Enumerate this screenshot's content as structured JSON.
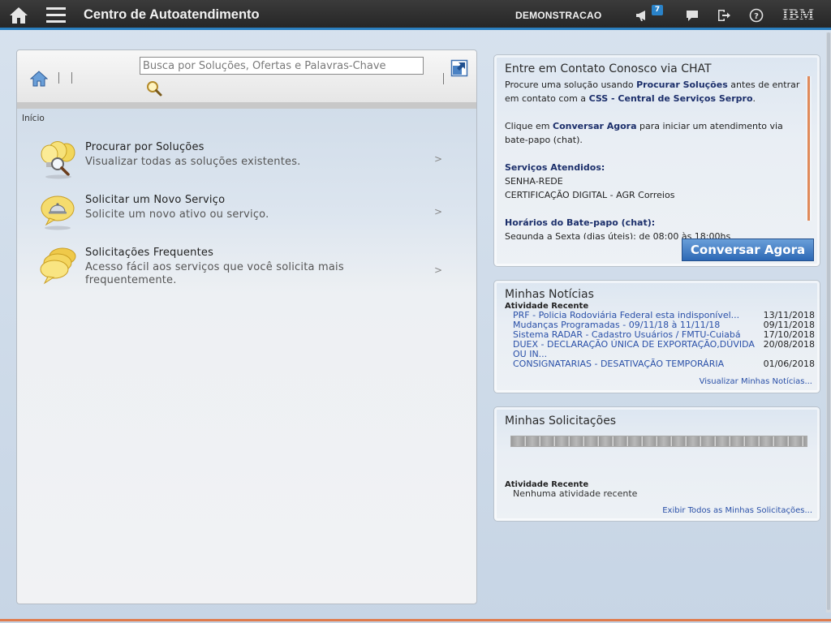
{
  "topbar": {
    "title": "Centro de Autoatendimento",
    "user": "DEMONSTRACAO",
    "notification_count": "7",
    "brand": "IBM",
    "accent_color": "#2a7fbf"
  },
  "search": {
    "placeholder": "Busca por Soluções, Ofertas e Palavras-Chave"
  },
  "breadcrumb": "Início",
  "menu": [
    {
      "title": "Procurar por Soluções",
      "description": "Visualizar todas as soluções existentes.",
      "icon": "lightbulb-search-icon",
      "chevron": ">"
    },
    {
      "title": "Solicitar um Novo Serviço",
      "description": "Solicite um novo ativo ou serviço.",
      "icon": "service-bell-icon",
      "chevron": ">"
    },
    {
      "title": "Solicitações Frequentes",
      "description": "Acesso fácil aos serviços que você solicita mais frequentemente.",
      "icon": "speech-bubbles-icon",
      "chevron": ">"
    }
  ],
  "chat": {
    "title": "Entre em Contato Conosco via CHAT",
    "p1_a": "Procure uma solução usando ",
    "p1_b": "Procurar Soluções",
    "p1_c": " antes de entrar em contato com a ",
    "p1_d": "CSS - Central de Serviços Serpro",
    "p1_e": ".",
    "p2_a": "Clique em ",
    "p2_b": "Conversar Agora",
    "p2_c": " para iniciar um atendimento via bate-papo (chat).",
    "services_label": "Serviços Atendidos:",
    "service_1": "SENHA-REDE",
    "service_2": "CERTIFICAÇÃO DIGITAL - AGR Correios",
    "hours_label": "Horários do Bate-papo (chat):",
    "hours_text": "Segunda a Sexta (dias úteis): de 08:00 às 18:00hs",
    "button": "Conversar Agora"
  },
  "news": {
    "title": "Minhas Notícias",
    "subtitle": "Atividade Recente",
    "items": [
      {
        "title": "PRF - Policia Rodoviária Federal esta indisponível...",
        "date": "13/11/2018"
      },
      {
        "title": "Mudanças Programadas - 09/11/18 à 11/11/18",
        "date": "09/11/2018"
      },
      {
        "title": "Sistema RADAR - Cadastro Usuários / FMTU-Cuiabá",
        "date": "17/10/2018"
      },
      {
        "title": "DUEX - DECLARAÇÃO ÚNICA DE EXPORTAÇÃO,DÚVIDA OU IN...",
        "date": "20/08/2018"
      },
      {
        "title": "CONSIGNATARIAS -  DESATIVAÇÃO TEMPORÁRIA",
        "date": "01/06/2018"
      }
    ],
    "view_all": "Visualizar Minhas Notícias..."
  },
  "requests": {
    "title": "Minhas Solicitações",
    "subtitle": "Atividade Recente",
    "empty": "Nenhuma atividade recente",
    "view_all": "Exibir Todos as Minhas Solicitações..."
  }
}
